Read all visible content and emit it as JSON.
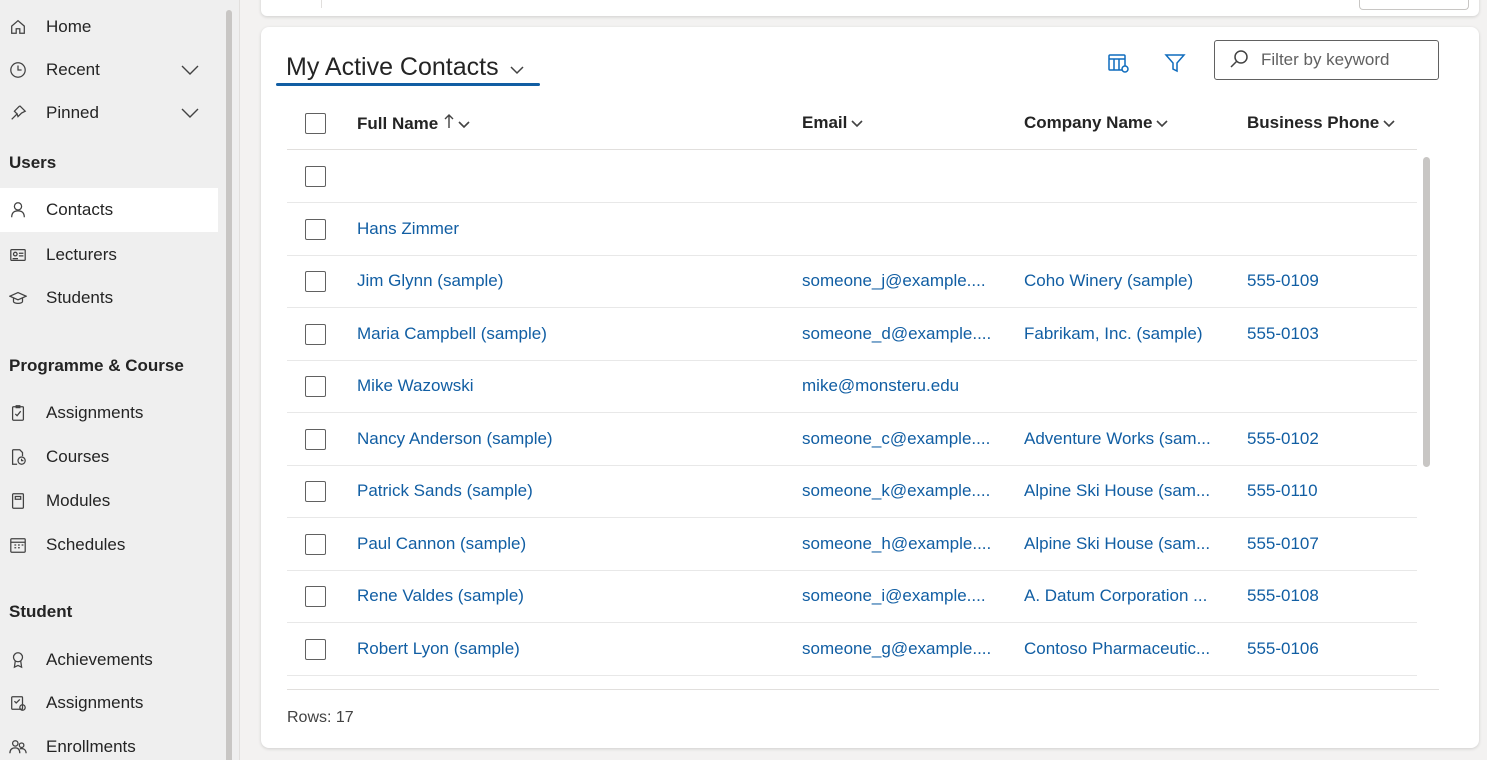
{
  "sidebar": {
    "items": [
      {
        "label": "Home",
        "icon": "home-icon"
      },
      {
        "label": "Recent",
        "icon": "clock-icon"
      },
      {
        "label": "Pinned",
        "icon": "pin-icon"
      }
    ],
    "sections": [
      {
        "title": "Users",
        "items": [
          {
            "label": "Contacts",
            "icon": "person-icon",
            "active": true
          },
          {
            "label": "Lecturers",
            "icon": "contact-card-icon"
          },
          {
            "label": "Students",
            "icon": "graduation-cap-icon"
          }
        ]
      },
      {
        "title": "Programme & Course",
        "items": [
          {
            "label": "Assignments",
            "icon": "clipboard-check-icon"
          },
          {
            "label": "Courses",
            "icon": "document-clock-icon"
          },
          {
            "label": "Modules",
            "icon": "book-icon"
          },
          {
            "label": "Schedules",
            "icon": "calendar-icon"
          }
        ]
      },
      {
        "title": "Student",
        "items": [
          {
            "label": "Achievements",
            "icon": "ribbon-icon"
          },
          {
            "label": "Assignments",
            "icon": "task-check-icon"
          },
          {
            "label": "Enrollments",
            "icon": "people-icon"
          }
        ]
      }
    ]
  },
  "view": {
    "title": "My Active Contacts",
    "search_placeholder": "Filter by keyword"
  },
  "grid": {
    "columns": [
      {
        "label": "Full Name",
        "sort": "ascending"
      },
      {
        "label": "Email"
      },
      {
        "label": "Company Name"
      },
      {
        "label": "Business Phone"
      }
    ],
    "rows": [
      {
        "name": "",
        "email": "",
        "company": "",
        "phone": ""
      },
      {
        "name": "Hans Zimmer",
        "email": "",
        "company": "",
        "phone": ""
      },
      {
        "name": "Jim Glynn (sample)",
        "email": "someone_j@example....",
        "company": "Coho Winery (sample)",
        "phone": "555-0109"
      },
      {
        "name": "Maria Campbell (sample)",
        "email": "someone_d@example....",
        "company": "Fabrikam, Inc. (sample)",
        "phone": "555-0103"
      },
      {
        "name": "Mike Wazowski",
        "email": "mike@monsteru.edu",
        "company": "",
        "phone": ""
      },
      {
        "name": "Nancy Anderson (sample)",
        "email": "someone_c@example....",
        "company": "Adventure Works (sam...",
        "phone": "555-0102"
      },
      {
        "name": "Patrick Sands (sample)",
        "email": "someone_k@example....",
        "company": "Alpine Ski House (sam...",
        "phone": "555-0110"
      },
      {
        "name": "Paul Cannon (sample)",
        "email": "someone_h@example....",
        "company": "Alpine Ski House (sam...",
        "phone": "555-0107"
      },
      {
        "name": "Rene Valdes (sample)",
        "email": "someone_i@example....",
        "company": "A. Datum Corporation ...",
        "phone": "555-0108"
      },
      {
        "name": "Robert Lyon (sample)",
        "email": "someone_g@example....",
        "company": "Contoso Pharmaceutic...",
        "phone": "555-0106"
      }
    ],
    "rows_label": "Rows: 17"
  },
  "colors": {
    "accent": "#115ea3",
    "link": "#115ea3",
    "sidebar_bg": "#efefef"
  }
}
